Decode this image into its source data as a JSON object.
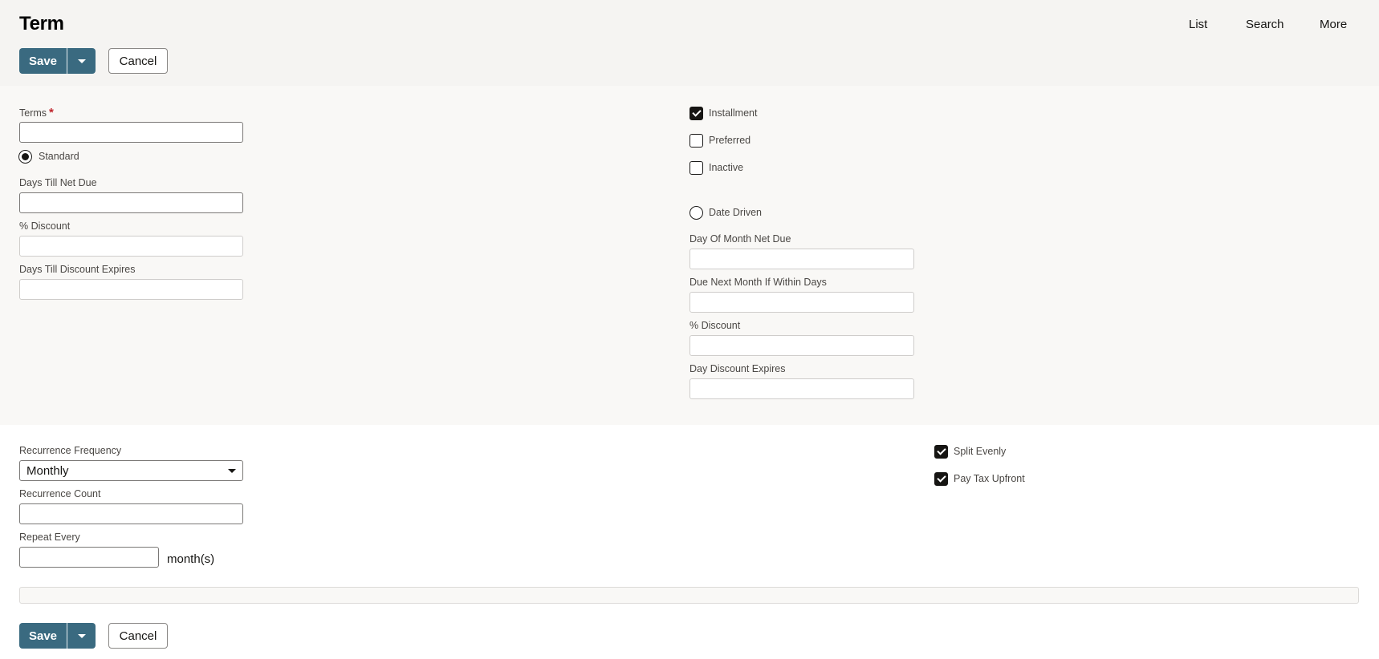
{
  "header": {
    "title": "Term",
    "nav": [
      "List",
      "Search",
      "More"
    ]
  },
  "toolbar": {
    "save_label": "Save",
    "cancel_label": "Cancel"
  },
  "standard": {
    "terms_label": "Terms",
    "terms_required": "*",
    "terms_value": "",
    "standard_radio_label": "Standard",
    "standard_selected": true,
    "days_till_net_due_label": "Days Till Net Due",
    "days_till_net_due_value": "",
    "discount_label": "% Discount",
    "discount_value": "",
    "days_till_discount_expires_label": "Days Till Discount Expires",
    "days_till_discount_expires_value": ""
  },
  "flags": {
    "installment_label": "Installment",
    "installment_checked": true,
    "preferred_label": "Preferred",
    "preferred_checked": false,
    "inactive_label": "Inactive",
    "inactive_checked": false
  },
  "date_driven": {
    "radio_label": "Date Driven",
    "selected": false,
    "day_of_month_net_due_label": "Day Of Month Net Due",
    "day_of_month_net_due_value": "",
    "due_next_month_label": "Due Next Month If Within Days",
    "due_next_month_value": "",
    "discount_label": "% Discount",
    "discount_value": "",
    "day_discount_expires_label": "Day Discount Expires",
    "day_discount_expires_value": ""
  },
  "installment": {
    "recurrence_frequency_label": "Recurrence Frequency",
    "recurrence_frequency_value": "Monthly",
    "recurrence_count_label": "Recurrence Count",
    "recurrence_count_value": "",
    "repeat_every_label": "Repeat Every",
    "repeat_every_value": "",
    "repeat_every_unit": "month(s)",
    "split_evenly_label": "Split Evenly",
    "split_evenly_checked": true,
    "pay_tax_upfront_label": "Pay Tax Upfront",
    "pay_tax_upfront_checked": true
  },
  "colors": {
    "primary_button": "#3a6a80",
    "header_bg": "#f5f4f2",
    "section_bg": "#f9f8f6",
    "required": "#c0262d"
  }
}
